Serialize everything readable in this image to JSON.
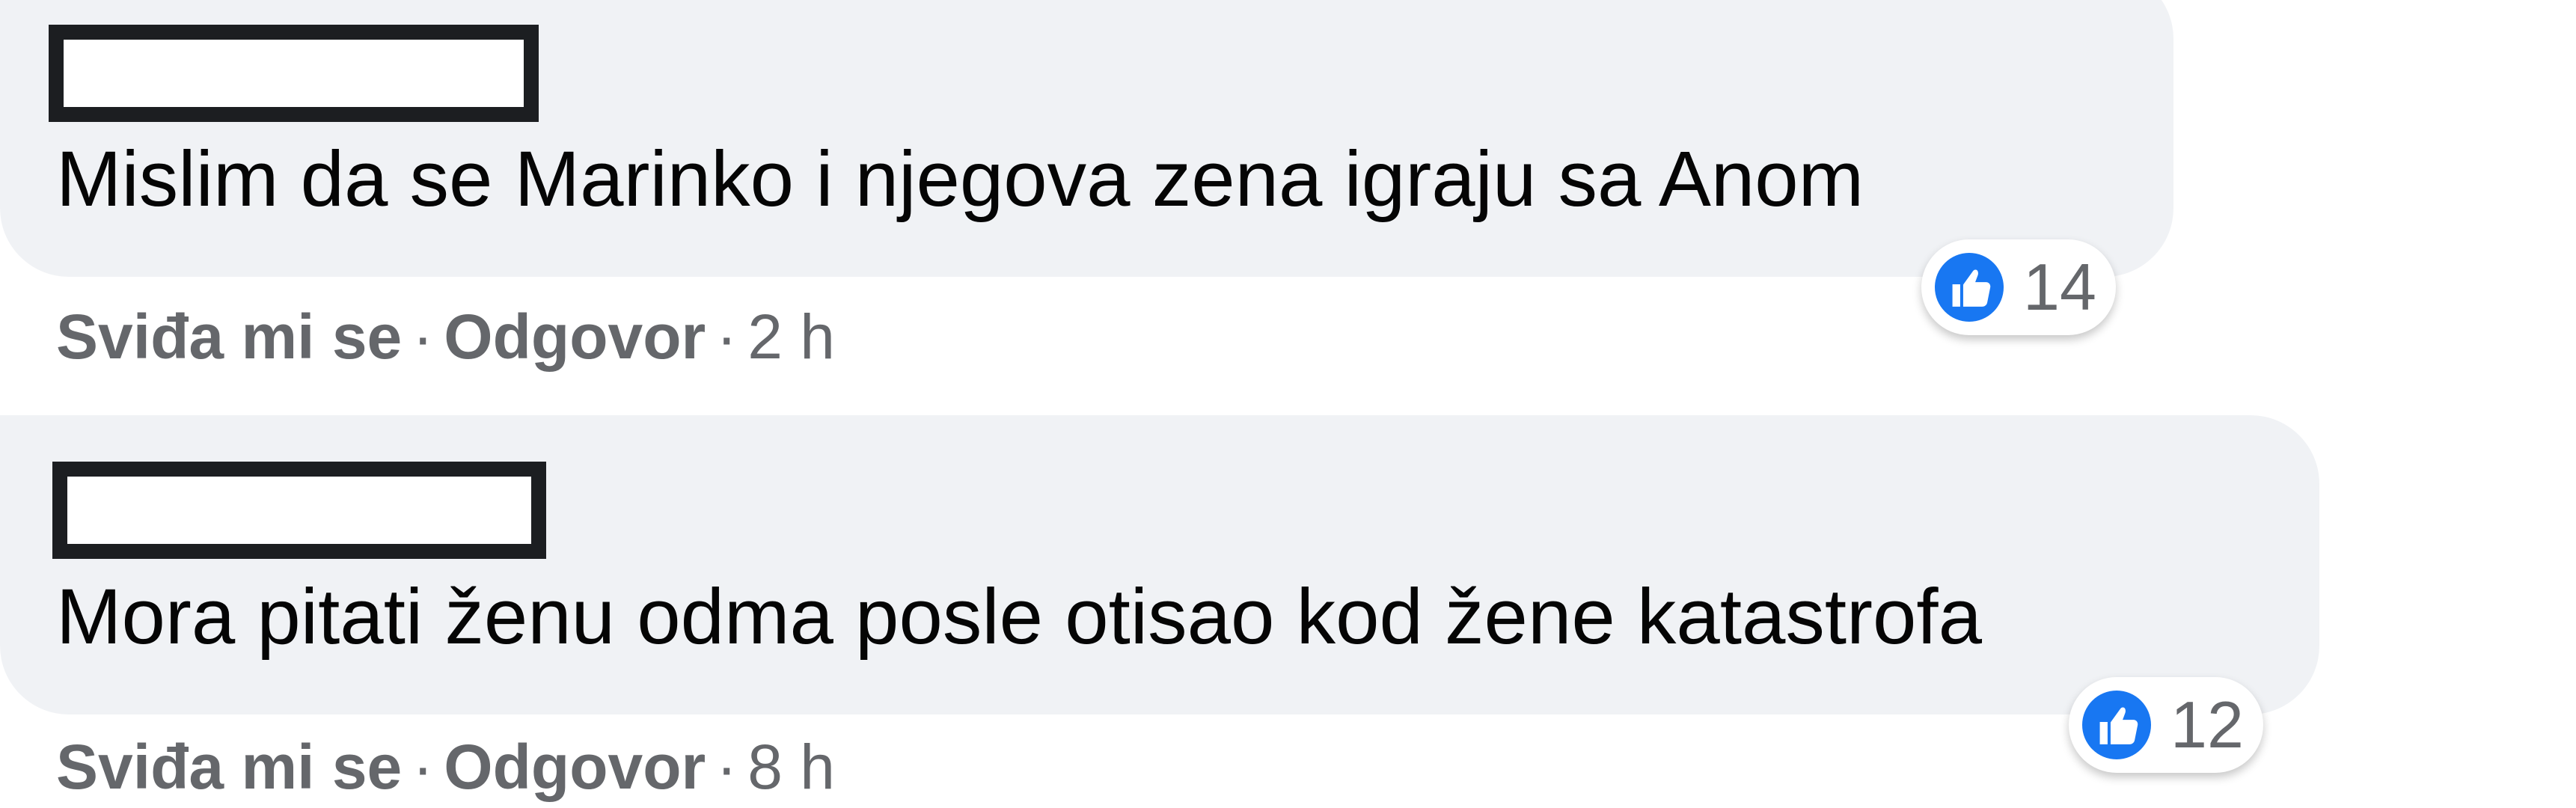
{
  "colors": {
    "bubble": "#f0f2f5",
    "text": "#050505",
    "secondary": "#65676b",
    "like_blue": "#1877f2"
  },
  "comments": [
    {
      "text": "Mislim da se Marinko i njegova zena igraju sa Anom",
      "reaction_icon": "like-icon",
      "reaction_count": "14",
      "like_label": "Sviđa mi se",
      "reply_label": "Odgovor",
      "separator": "·",
      "time": "2 h"
    },
    {
      "text": "Mora pitati ženu odma posle otisao kod žene katastrofa",
      "reaction_icon": "like-icon",
      "reaction_count": "12",
      "like_label": "Sviđa mi se",
      "reply_label": "Odgovor",
      "separator": "·",
      "time": "8 h"
    }
  ]
}
